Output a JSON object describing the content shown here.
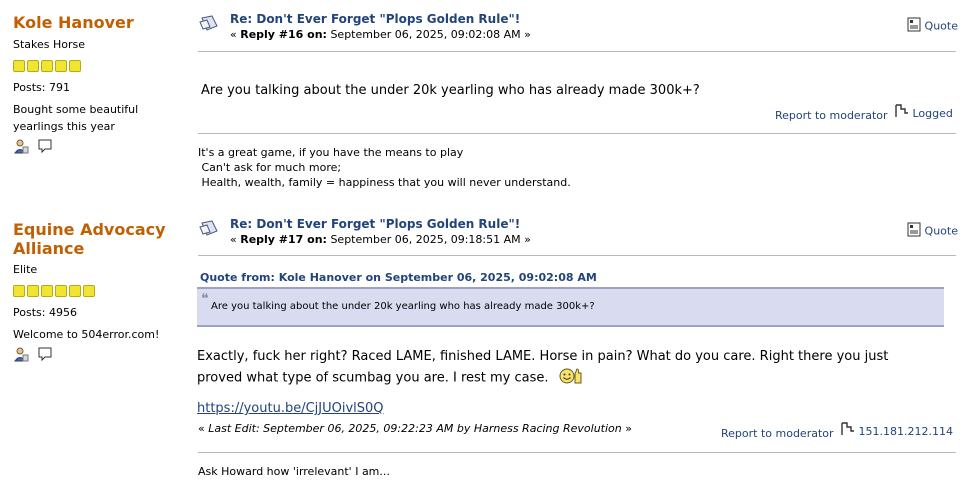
{
  "posts": [
    {
      "author": "Kole Hanover",
      "rank": "Stakes Horse",
      "stars": 5,
      "posts_label": "Posts: 791",
      "personal_text": "Bought some beautiful yearlings this year",
      "title": "Re: Don't Ever Forget \"Plops Golden Rule\"!",
      "subline_prefix": "« ",
      "reply_label": "Reply #16 on:",
      "date": " September 06, 2025, 09:02:08 AM »",
      "quote_label": "Quote",
      "body": "Are you talking about the under 20k yearling who has already made 300k+?",
      "report_label": "Report to moderator",
      "logged_label": "Logged",
      "signature": [
        "It's a great game, if you have the means to play",
        " Can't ask for much more;",
        " Health, wealth, family = happiness that you will never understand."
      ]
    },
    {
      "author": "Equine Advocacy Alliance",
      "rank": "Elite",
      "stars": 6,
      "posts_label": "Posts: 4956",
      "personal_text": "Welcome to 504error.com!",
      "title": "Re: Don't Ever Forget \"Plops Golden Rule\"!",
      "subline_prefix": "« ",
      "reply_label": "Reply #17 on:",
      "date": " September 06, 2025, 09:18:51 AM »",
      "quote_label": "Quote",
      "quote_header": "Quote from: Kole Hanover on September 06, 2025, 09:02:08 AM",
      "quote_text": "Are you talking about the under 20k yearling who has already made 300k+?",
      "body": "Exactly, fuck her right? Raced LAME, finished LAME. Horse in pain? What do you care. Right there you just proved what type of scumbag you are. I rest my case.",
      "link": "https://youtu.be/CjJUOivlS0Q",
      "last_edit": "Last Edit: September 06, 2025, 09:22:23 AM by Harness Racing Revolution",
      "report_label": "Report to moderator",
      "ip": "151.181.212.114",
      "signature": [
        "Ask Howard how 'irrelevant' I am..."
      ]
    }
  ]
}
